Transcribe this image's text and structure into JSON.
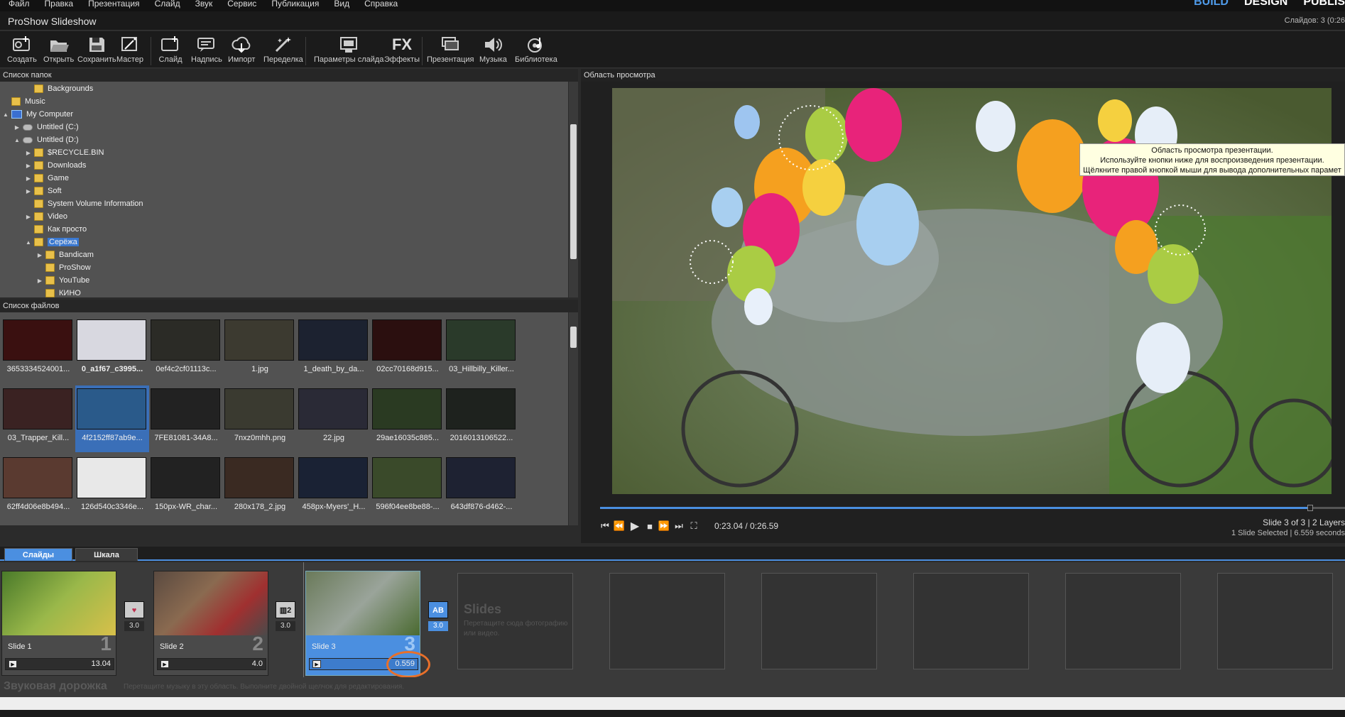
{
  "menu": [
    "Файл",
    "Правка",
    "Презентация",
    "Слайд",
    "Звук",
    "Сервис",
    "Публикация",
    "Вид",
    "Справка"
  ],
  "modes": {
    "build": "BUILD",
    "design": "DESIGN",
    "publish": "PUBLIS"
  },
  "title": "ProShow Slideshow",
  "slidecount": "Слайдов: 3 (0:26",
  "toolbar": [
    "Создать",
    "Открыть",
    "Сохранить",
    "Мастер",
    "Слайд",
    "Надпись",
    "Импорт",
    "Переделка",
    "Параметры слайда",
    "Эффекты",
    "Презентация",
    "Музыка",
    "Библиотека"
  ],
  "folders_title": "Список папок",
  "folders": [
    {
      "label": "Backgrounds",
      "tri": ""
    },
    {
      "label": "Music",
      "tri": ""
    },
    {
      "label": "My Computer",
      "tri": "▲"
    },
    {
      "label": "Untitled (C:)",
      "tri": "▶"
    },
    {
      "label": "Untitled (D:)",
      "tri": "▲"
    },
    {
      "label": "$RECYCLE.BIN",
      "tri": "▶"
    },
    {
      "label": "Downloads",
      "tri": "▶"
    },
    {
      "label": "Game",
      "tri": "▶"
    },
    {
      "label": "Soft",
      "tri": "▶"
    },
    {
      "label": "System Volume Information",
      "tri": ""
    },
    {
      "label": "Video",
      "tri": "▶"
    },
    {
      "label": "Как просто",
      "tri": ""
    },
    {
      "label": "Серёжа",
      "tri": "▲"
    },
    {
      "label": "Bandicam",
      "tri": "▶"
    },
    {
      "label": "ProShow",
      "tri": ""
    },
    {
      "label": "YouTube",
      "tri": "▶"
    },
    {
      "label": "КИНО",
      "tri": ""
    }
  ],
  "files_title": "Список файлов",
  "files": [
    {
      "name": "3653334524001...",
      "color": "#3a1010"
    },
    {
      "name": "0_a1f67_c3995...",
      "color": "#d8d8e0"
    },
    {
      "name": "0ef4c2cf01113c...",
      "color": "#2b2b26"
    },
    {
      "name": "1.jpg",
      "color": "#3c3a30"
    },
    {
      "name": "1_death_by_da...",
      "color": "#1c2230"
    },
    {
      "name": "02cc70168d915...",
      "color": "#2b0f0f"
    },
    {
      "name": "03_Hillbilly_Killer...",
      "color": "#2a3a2a"
    },
    {
      "name": "03_Trapper_Kill...",
      "color": "#3a2222"
    },
    {
      "name": "4f2152ff87ab9e...",
      "color": "#2a5a8a"
    },
    {
      "name": "7FE81081-34A8...",
      "color": "#222222"
    },
    {
      "name": "7nxz0mhh.png",
      "color": "#3a3a30"
    },
    {
      "name": "22.jpg",
      "color": "#2a2a36"
    },
    {
      "name": "29ae16035c885...",
      "color": "#2a3a22"
    },
    {
      "name": "2016013106522...",
      "color": "#1e221e"
    },
    {
      "name": "62ff4d06e8b494...",
      "color": "#5a3a30"
    },
    {
      "name": "126d540c3346e...",
      "color": "#e8e8e8"
    },
    {
      "name": "150px-WR_char...",
      "color": "#222222"
    },
    {
      "name": "280x178_2.jpg",
      "color": "#3a2a22"
    },
    {
      "name": "458px-Myers'_H...",
      "color": "#1a2234"
    },
    {
      "name": "596f04ee8be88-...",
      "color": "#3a4a2a"
    },
    {
      "name": "643df876-d462-...",
      "color": "#1e2232"
    }
  ],
  "preview_title": "Область просмотра",
  "tooltip": [
    "Область просмотра презентации.",
    "Используйте кнопки ниже для воспроизведения презентации.",
    "Щёлкните правой кнопкой мыши для вывода дополнительных парамет"
  ],
  "playback": {
    "time": "0:23.04 / 0:26.59",
    "progress": 0.953
  },
  "slide_info": "Slide 3 of 3  |  2 Layers",
  "slide_info2": "1 Slide Selected  |  6.559 seconds",
  "tabs": [
    "Слайды",
    "Шкала"
  ],
  "slides": [
    {
      "name": "Slide 1",
      "num": "1",
      "dur": "13.04",
      "color": "#6a8a3a"
    },
    {
      "name": "Slide 2",
      "num": "2",
      "dur": "4.0",
      "color": "#6a5040"
    },
    {
      "name": "Slide 3",
      "num": "3",
      "dur": "0.559",
      "color": "#7a8a60"
    }
  ],
  "transitions": [
    {
      "icon": "♥",
      "time": "3.0"
    },
    {
      "icon": "▥2",
      "time": "3.0"
    },
    {
      "icon": "AB",
      "time": "3.0"
    }
  ],
  "empty_slot": {
    "title": "Slides",
    "hint": "Перетащите сюда фотографию или видео."
  },
  "audio": {
    "title": "Звуковая дорожка",
    "hint": "Перетащите музыку в эту область. Выполните двойной щелчок для редактирования."
  }
}
